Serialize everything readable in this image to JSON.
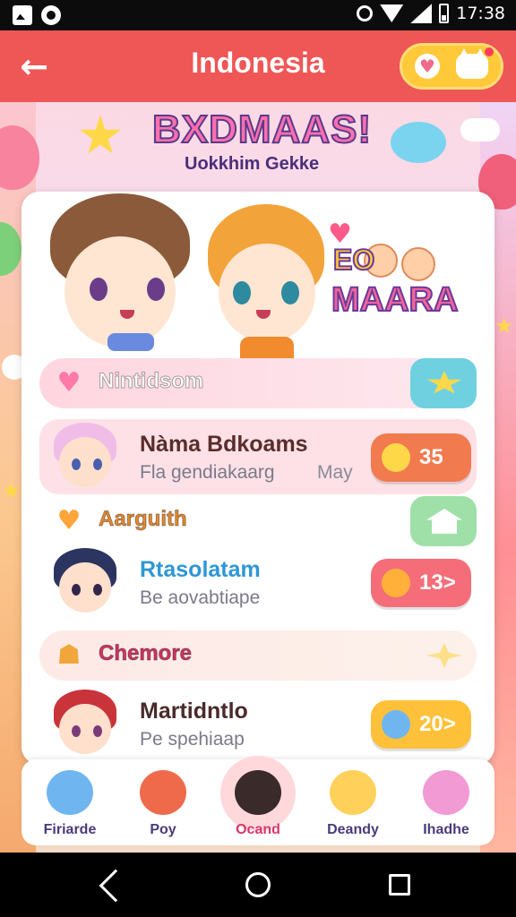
{
  "status_bar": {
    "time": "17:38"
  },
  "app_bar": {
    "title": "Indonesia",
    "back_icon": "←",
    "heart_icon": "♥"
  },
  "banner": {
    "title": "BXDMAAS!",
    "subtitle": "Uokkhim Gekke"
  },
  "hero": {
    "logo_top": "EO",
    "logo_main": "MAARA"
  },
  "sections": [
    {
      "label": "Nintidsom",
      "icon": "♥",
      "color": "#f25b8f"
    },
    {
      "label": "Aarguith",
      "icon": "♥",
      "color": "#d9741a"
    },
    {
      "label": "Chemore",
      "icon": "☗",
      "color": "#d13464"
    }
  ],
  "rows": [
    {
      "name": "Nàma Bdkoams",
      "sub": "Fla gendiakaarg",
      "extra": "May",
      "count": "35",
      "name_color": "#5a2d2d"
    },
    {
      "name": "Rtasolatam",
      "sub": "Be aovabtiape",
      "extra": "",
      "count": "13>",
      "name_color": "#2f96d6"
    },
    {
      "name": "Martidntlo",
      "sub": "Pe spehiaap",
      "extra": "",
      "count": "20>",
      "name_color": "#4a2a2a"
    }
  ],
  "tabs": [
    {
      "label": "Firiarde",
      "active": false
    },
    {
      "label": "Poy",
      "active": false
    },
    {
      "label": "Ocand",
      "active": true
    },
    {
      "label": "Deandy",
      "active": false
    },
    {
      "label": "Ihadhe",
      "active": false
    }
  ]
}
